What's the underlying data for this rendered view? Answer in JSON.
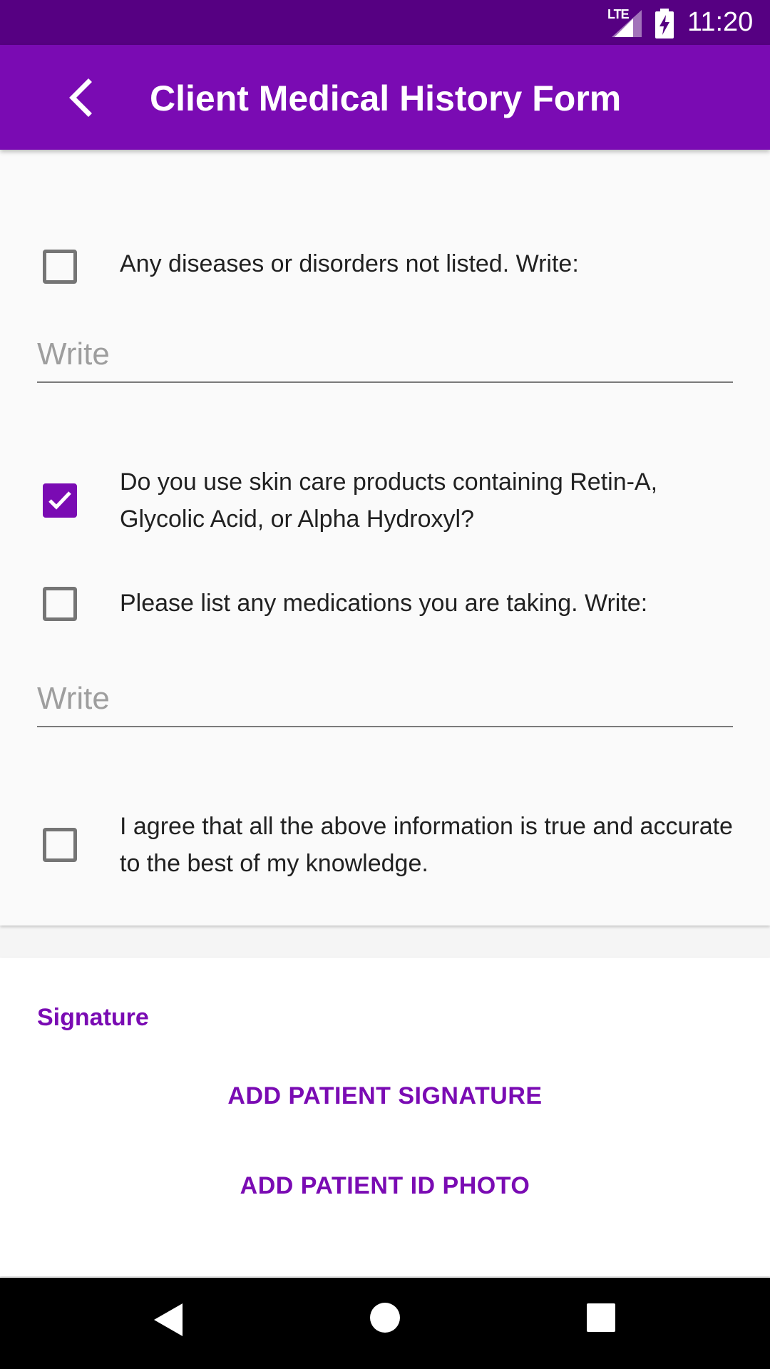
{
  "status_bar": {
    "network": "LTE",
    "time": "11:20"
  },
  "app_bar": {
    "title": "Client Medical History Form"
  },
  "form": {
    "fields": [
      {
        "placeholder": "Write",
        "value": ""
      },
      {
        "placeholder": "Write",
        "value": ""
      },
      {
        "placeholder": "Write",
        "value": ""
      }
    ],
    "checks": [
      {
        "label": "Any diseases or disorders not listed. Write:",
        "checked": false
      },
      {
        "label": "Do you use skin care products containing Retin-A, Glycolic Acid, or Alpha Hydroxyl?",
        "checked": true
      },
      {
        "label": "Please list any medications you are taking.   Write:",
        "checked": false
      },
      {
        "label": "I agree that all the above information is true and accurate to the best of my knowledge.",
        "checked": false
      }
    ]
  },
  "signature": {
    "section_label": "Signature",
    "add_signature_label": "ADD PATIENT SIGNATURE",
    "add_id_photo_label": "ADD PATIENT ID PHOTO"
  },
  "colors": {
    "status_bar": "#560082",
    "app_bar": "#7a0bb3",
    "accent": "#7a0bb3"
  },
  "icons": {
    "back": "chevron-left-icon",
    "nav_back": "triangle-back-icon",
    "nav_home": "circle-home-icon",
    "nav_recent": "square-recents-icon"
  }
}
